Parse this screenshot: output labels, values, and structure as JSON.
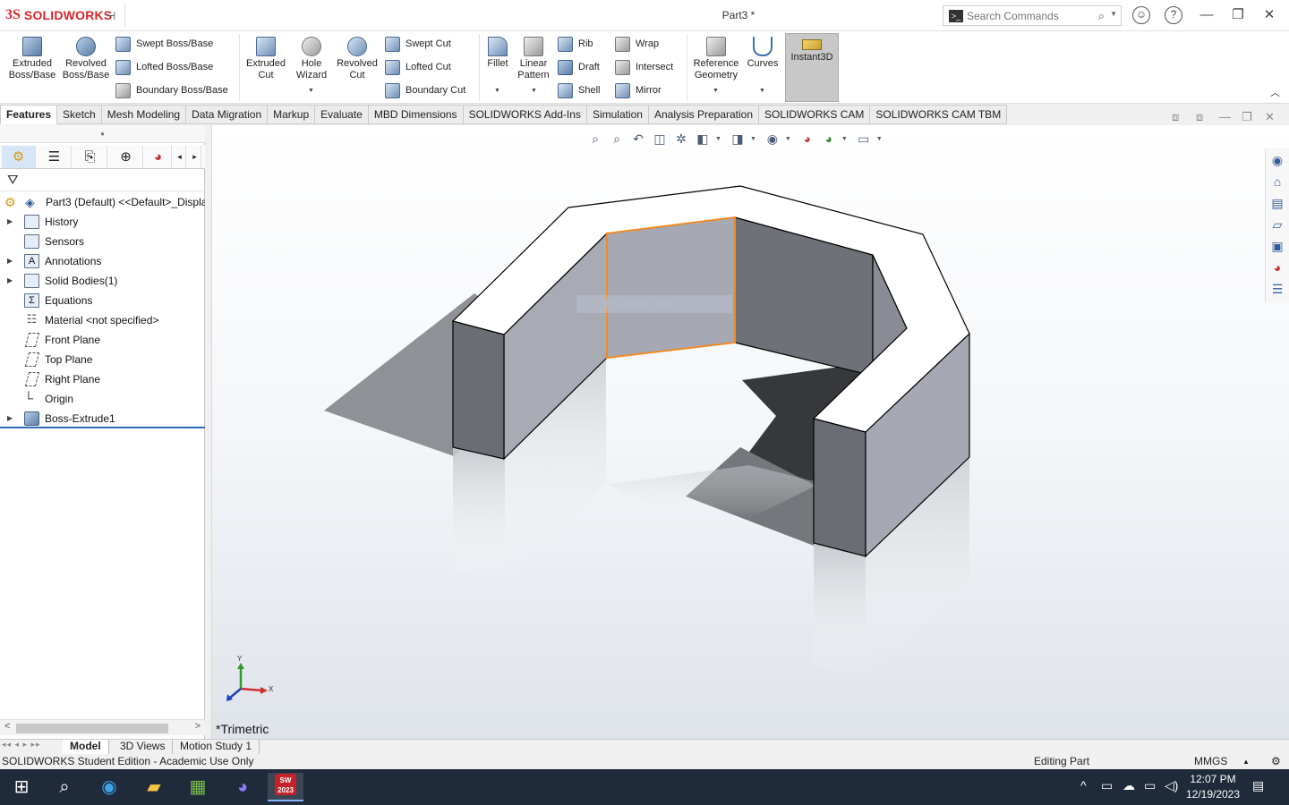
{
  "app": {
    "logo_ds": "3S",
    "logo_text": "SOLIDWORKS",
    "doc_title": "Part3 *"
  },
  "search": {
    "placeholder": "Search Commands"
  },
  "ribbon": {
    "extruded_boss": "Extruded Boss/Base",
    "revolved_boss": "Revolved Boss/Base",
    "swept_boss": "Swept Boss/Base",
    "lofted_boss": "Lofted Boss/Base",
    "boundary_boss": "Boundary Boss/Base",
    "extruded_cut": "Extruded Cut",
    "hole_wizard": "Hole Wizard",
    "revolved_cut": "Revolved Cut",
    "swept_cut": "Swept Cut",
    "lofted_cut": "Lofted Cut",
    "boundary_cut": "Boundary Cut",
    "fillet": "Fillet",
    "linear_pattern": "Linear Pattern",
    "rib": "Rib",
    "draft": "Draft",
    "shell": "Shell",
    "wrap": "Wrap",
    "intersect": "Intersect",
    "mirror": "Mirror",
    "reference_geometry": "Reference Geometry",
    "curves": "Curves",
    "instant3d": "Instant3D"
  },
  "tabs": [
    "Features",
    "Sketch",
    "Mesh Modeling",
    "Data Migration",
    "Markup",
    "Evaluate",
    "MBD Dimensions",
    "SOLIDWORKS Add-Ins",
    "Simulation",
    "Analysis Preparation",
    "SOLIDWORKS CAM",
    "SOLIDWORKS CAM TBM"
  ],
  "tree": {
    "root": "Part3 (Default) <<Default>_Displa",
    "items": [
      "History",
      "Sensors",
      "Annotations",
      "Solid Bodies(1)",
      "Equations",
      "Material <not specified>",
      "Front Plane",
      "Top Plane",
      "Right Plane",
      "Origin",
      "Boss-Extrude1"
    ]
  },
  "viewport": {
    "view_name": "*Trimetric",
    "snip_overlay": "Full-screen Snip",
    "triad_y": "Y",
    "triad_x": "X"
  },
  "bottom_tabs": [
    "Model",
    "3D Views",
    "Motion Study 1"
  ],
  "status": {
    "left": "SOLIDWORKS Student Edition - Academic Use Only",
    "mode": "Editing Part",
    "units": "MMGS"
  },
  "taskbar": {
    "time": "12:07 PM",
    "date": "12/19/2023",
    "sw_badge": "2023"
  },
  "colors": {
    "brand": "#d6242b",
    "selection": "#f08a24",
    "taskbar": "#1f2a3a"
  }
}
